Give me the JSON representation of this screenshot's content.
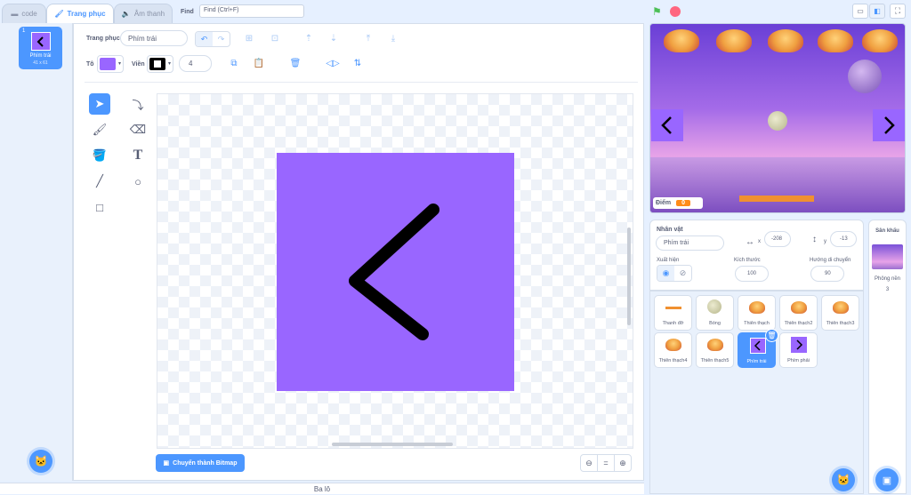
{
  "tabs": {
    "code": "code",
    "costumes": "Trang phục",
    "sounds": "Âm thanh"
  },
  "find": {
    "label": "Find",
    "placeholder": "Find (Ctrl+F)"
  },
  "costume_list": [
    {
      "number": "1",
      "name": "Phím trái",
      "size": "41 x 61"
    }
  ],
  "editor": {
    "costume_label": "Trang phục",
    "costume_name": "Phím trái",
    "fill_label": "Tô",
    "fill_color": "#9966ff",
    "outline_label": "Viền",
    "outline_width": "4",
    "bitmap_button": "Chuyển thành Bitmap",
    "zoom_equal": "="
  },
  "backpack": "Ba lô",
  "stage": {
    "score_label": "Điểm",
    "score_value": "0"
  },
  "sprite_info": {
    "sprite_label": "Nhân vật",
    "sprite_name": "Phím trái",
    "x_label": "x",
    "x_value": "-208",
    "y_label": "y",
    "y_value": "-13",
    "show_label": "Xuất hiện",
    "size_label": "Kích thước",
    "size_value": "100",
    "direction_label": "Hướng di chuyển",
    "direction_value": "90"
  },
  "sprites": [
    {
      "name": "Thanh đỡ"
    },
    {
      "name": "Bóng"
    },
    {
      "name": "Thiên thạch"
    },
    {
      "name": "Thiên thạch2"
    },
    {
      "name": "Thiên thạch3"
    },
    {
      "name": "Thiên thạch4"
    },
    {
      "name": "Thiên thạch5"
    },
    {
      "name": "Phím trái"
    },
    {
      "name": "Phím phải"
    }
  ],
  "stage_panel": {
    "title": "Sân khấu",
    "backdrops_label": "Phông nền",
    "backdrops_count": "3"
  },
  "colors": {
    "accent": "#4c97ff",
    "purple": "#9966ff",
    "orange": "#ff8c1a",
    "green_flag": "#4cbf56",
    "stop": "#ff6680"
  }
}
